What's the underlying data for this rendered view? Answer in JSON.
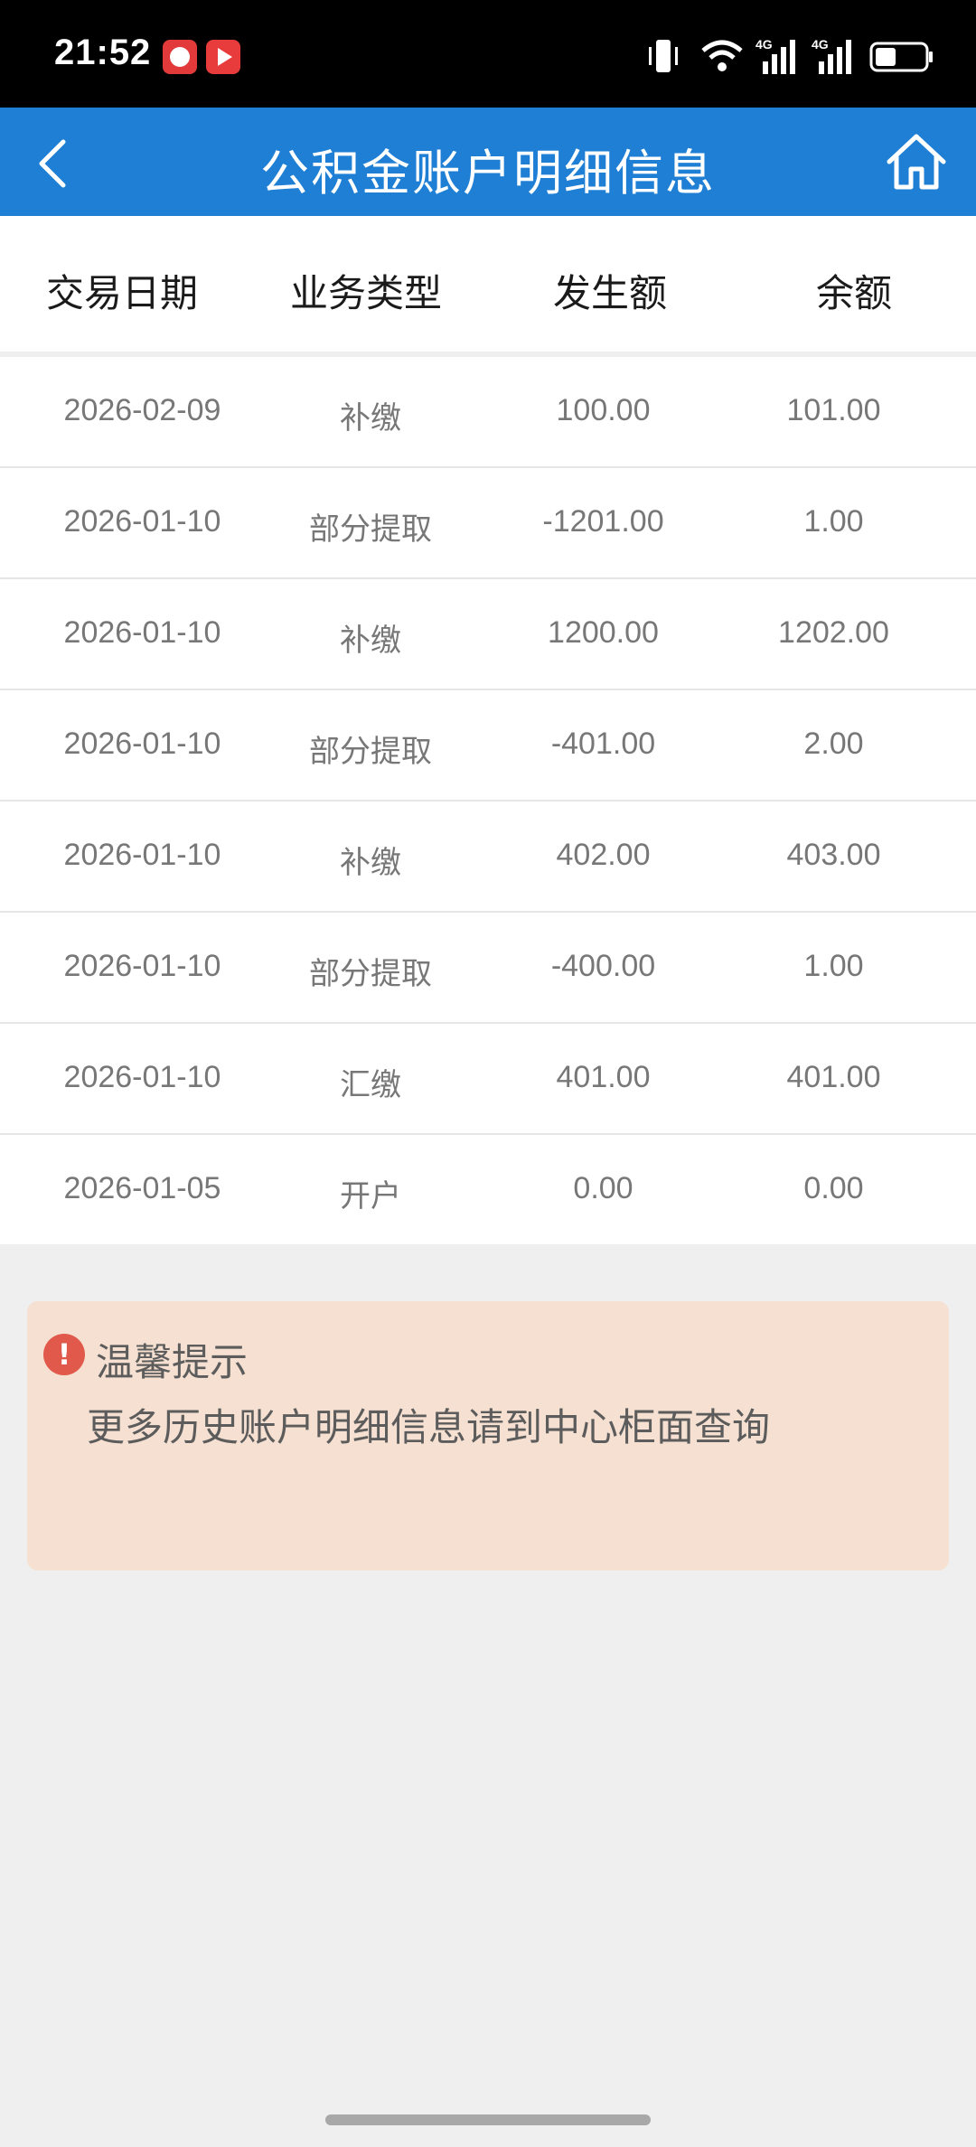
{
  "status_bar": {
    "time": "21:52",
    "icons": [
      "app-icon",
      "video-app-icon",
      "vibrate-icon",
      "wifi-icon",
      "signal-4g-icon",
      "signal-4g-icon",
      "battery-icon"
    ]
  },
  "header": {
    "title": "公积金账户明细信息",
    "back_icon": "chevron-left-icon",
    "home_icon": "home-icon",
    "bg_color": "#1e7fd5"
  },
  "table": {
    "columns": [
      "交易日期",
      "业务类型",
      "发生额",
      "余额"
    ],
    "rows": [
      [
        "2026-02-09",
        "补缴",
        "100.00",
        "101.00"
      ],
      [
        "2026-01-10",
        "部分提取",
        "-1201.00",
        "1.00"
      ],
      [
        "2026-01-10",
        "补缴",
        "1200.00",
        "1202.00"
      ],
      [
        "2026-01-10",
        "部分提取",
        "-401.00",
        "2.00"
      ],
      [
        "2026-01-10",
        "补缴",
        "402.00",
        "403.00"
      ],
      [
        "2026-01-10",
        "部分提取",
        "-400.00",
        "1.00"
      ],
      [
        "2026-01-10",
        "汇缴",
        "401.00",
        "401.00"
      ],
      [
        "2026-01-05",
        "开户",
        "0.00",
        "0.00"
      ]
    ]
  },
  "tip": {
    "icon": "exclamation-icon",
    "icon_glyph": "!",
    "title": "温馨提示",
    "text": "更多历史账户明细信息请到中心柜面查询",
    "bg_color": "#f5e0d1"
  }
}
